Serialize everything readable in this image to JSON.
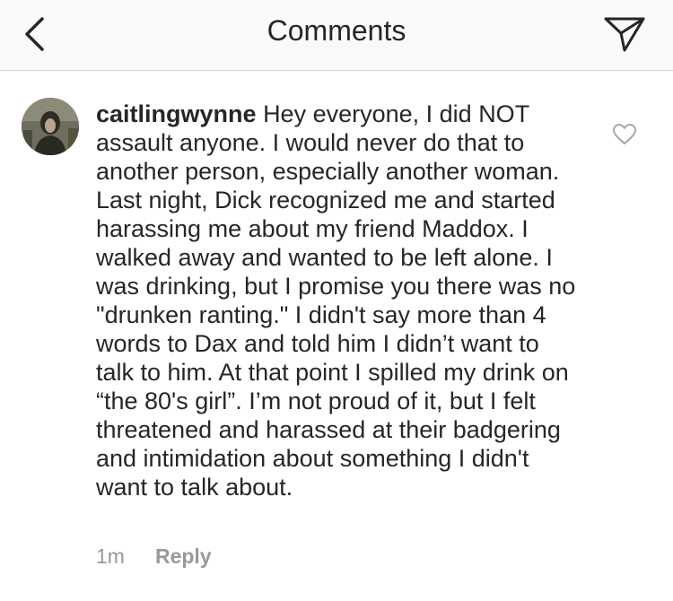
{
  "header": {
    "title": "Comments",
    "back_icon": "chevron-left-icon",
    "send_icon": "paper-plane-icon"
  },
  "comment": {
    "username": "caitlingwynne",
    "text": "Hey everyone, I did NOT assault anyone. I would never do that to another person, especially another woman. Last night, Dick recognized me and started harassing me about my friend Maddox. I walked away and wanted to be left alone. I was drinking, but I promise you there was no \"drunken ranting.\" I didn't say more than 4 words to Dax and told him I didn’t want to talk to him. At that point I spilled my drink on “the 80's girl”. I’m not proud of it, but I felt threatened and harassed at their badgering and intimidation about something I didn't want to talk about.",
    "timestamp": "1m",
    "reply_label": "Reply",
    "like_icon": "heart-outline-icon"
  },
  "colors": {
    "header_bg": "#f9f9f9",
    "text": "#262626",
    "muted": "#999999"
  }
}
